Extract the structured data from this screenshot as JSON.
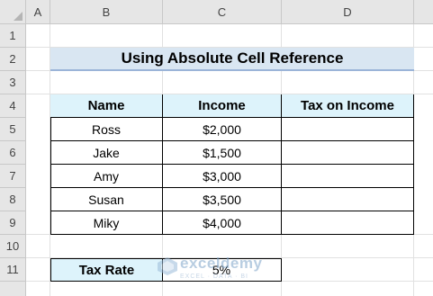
{
  "columns": [
    "A",
    "B",
    "C",
    "D"
  ],
  "rows": [
    "1",
    "2",
    "3",
    "4",
    "5",
    "6",
    "7",
    "8",
    "9",
    "10",
    "11"
  ],
  "title": "Using Absolute Cell Reference",
  "table": {
    "headers": [
      "Name",
      "Income",
      "Tax on Income"
    ],
    "rows": [
      {
        "name": "Ross",
        "income": "$2,000",
        "tax": ""
      },
      {
        "name": "Jake",
        "income": "$1,500",
        "tax": ""
      },
      {
        "name": "Amy",
        "income": "$3,000",
        "tax": ""
      },
      {
        "name": "Susan",
        "income": "$3,500",
        "tax": ""
      },
      {
        "name": "Miky",
        "income": "$4,000",
        "tax": ""
      }
    ]
  },
  "tax_rate": {
    "label": "Tax Rate",
    "value": "5%"
  },
  "watermark": {
    "name": "exceldemy",
    "tagline": "EXCEL · DATA · BI"
  },
  "colors": {
    "header_fill": "#ddf3fb",
    "title_fill": "#d9e6f2",
    "title_underline": "#9bb4d8",
    "header_bar": "#e6e6e6"
  },
  "icons": {
    "corner": "select-all-triangle",
    "watermark": "exceldemy-logo-icon"
  }
}
